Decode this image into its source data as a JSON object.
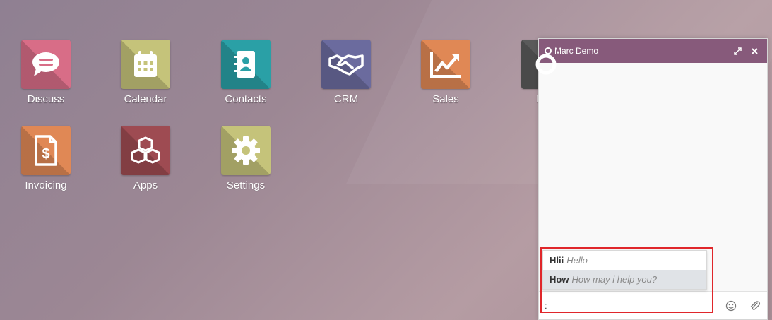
{
  "apps": [
    {
      "id": "discuss",
      "label": "Discuss",
      "icon": "chat-bubble-icon",
      "color": "#d86d87"
    },
    {
      "id": "calendar",
      "label": "Calendar",
      "icon": "calendar-icon",
      "color": "#c5c37a"
    },
    {
      "id": "contacts",
      "label": "Contacts",
      "icon": "address-book-icon",
      "color": "#2aa0a6"
    },
    {
      "id": "crm",
      "label": "CRM",
      "icon": "handshake-icon",
      "color": "#6b6b9e"
    },
    {
      "id": "sales",
      "label": "Sales",
      "icon": "chart-line-icon",
      "color": "#e08855"
    },
    {
      "id": "link",
      "label": "Link",
      "icon": "link-icon",
      "color": "#5a5a5a"
    },
    {
      "id": "invoicing",
      "label": "Invoicing",
      "icon": "invoice-icon",
      "color": "#e08855"
    },
    {
      "id": "apps",
      "label": "Apps",
      "icon": "cubes-icon",
      "color": "#9e4b52"
    },
    {
      "id": "settings",
      "label": "Settings",
      "icon": "gear-icon",
      "color": "#c5c37a"
    }
  ],
  "chat": {
    "title": "Marc Demo",
    "status": "offline",
    "input_value": ":",
    "suggestions": [
      {
        "shortcut": "Hlii",
        "text": "Hello",
        "active": false
      },
      {
        "shortcut": "How",
        "text": "How may i help you?",
        "active": true
      }
    ],
    "header_color": "#875a7b"
  }
}
